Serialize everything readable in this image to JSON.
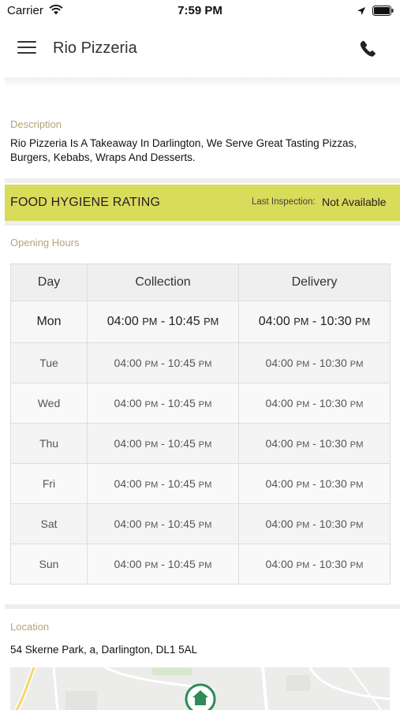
{
  "status_bar": {
    "carrier": "Carrier",
    "time": "7:59 PM"
  },
  "header": {
    "title": "Rio Pizzeria"
  },
  "description": {
    "label": "Description",
    "text": "Rio Pizzeria Is A Takeaway In Darlington, We Serve Great Tasting Pizzas, Burgers, Kebabs, Wraps And Desserts."
  },
  "hygiene": {
    "title": "FOOD HYGIENE RATING",
    "last_inspection_label": "Last Inspection:",
    "last_inspection_value": "Not Available"
  },
  "opening_hours": {
    "label": "Opening Hours",
    "columns": [
      "Day",
      "Collection",
      "Delivery"
    ],
    "rows": [
      {
        "day": "Mon",
        "collection": {
          "start": "04:00",
          "start_ampm": "PM",
          "end": "10:45",
          "end_ampm": "PM"
        },
        "delivery": {
          "start": "04:00",
          "start_ampm": "PM",
          "end": "10:30",
          "end_ampm": "PM"
        }
      },
      {
        "day": "Tue",
        "collection": {
          "start": "04:00",
          "start_ampm": "PM",
          "end": "10:45",
          "end_ampm": "PM"
        },
        "delivery": {
          "start": "04:00",
          "start_ampm": "PM",
          "end": "10:30",
          "end_ampm": "PM"
        }
      },
      {
        "day": "Wed",
        "collection": {
          "start": "04:00",
          "start_ampm": "PM",
          "end": "10:45",
          "end_ampm": "PM"
        },
        "delivery": {
          "start": "04:00",
          "start_ampm": "PM",
          "end": "10:30",
          "end_ampm": "PM"
        }
      },
      {
        "day": "Thu",
        "collection": {
          "start": "04:00",
          "start_ampm": "PM",
          "end": "10:45",
          "end_ampm": "PM"
        },
        "delivery": {
          "start": "04:00",
          "start_ampm": "PM",
          "end": "10:30",
          "end_ampm": "PM"
        }
      },
      {
        "day": "Fri",
        "collection": {
          "start": "04:00",
          "start_ampm": "PM",
          "end": "10:45",
          "end_ampm": "PM"
        },
        "delivery": {
          "start": "04:00",
          "start_ampm": "PM",
          "end": "10:30",
          "end_ampm": "PM"
        }
      },
      {
        "day": "Sat",
        "collection": {
          "start": "04:00",
          "start_ampm": "PM",
          "end": "10:45",
          "end_ampm": "PM"
        },
        "delivery": {
          "start": "04:00",
          "start_ampm": "PM",
          "end": "10:30",
          "end_ampm": "PM"
        }
      },
      {
        "day": "Sun",
        "collection": {
          "start": "04:00",
          "start_ampm": "PM",
          "end": "10:45",
          "end_ampm": "PM"
        },
        "delivery": {
          "start": "04:00",
          "start_ampm": "PM",
          "end": "10:30",
          "end_ampm": "PM"
        }
      }
    ]
  },
  "location": {
    "label": "Location",
    "address": "54 Skerne Park, a, Darlington, DL1 5AL"
  },
  "icons": {
    "menu": "hamburger-menu-icon",
    "phone": "phone-icon",
    "map_marker": "home-pin-icon",
    "wifi": "wifi-icon",
    "location_arrow": "location-arrow-icon",
    "battery": "battery-icon"
  },
  "colors": {
    "accent_label": "#b7a27a",
    "hygiene_bar": "#d9db5a",
    "map_pin": "#2e8b57"
  }
}
